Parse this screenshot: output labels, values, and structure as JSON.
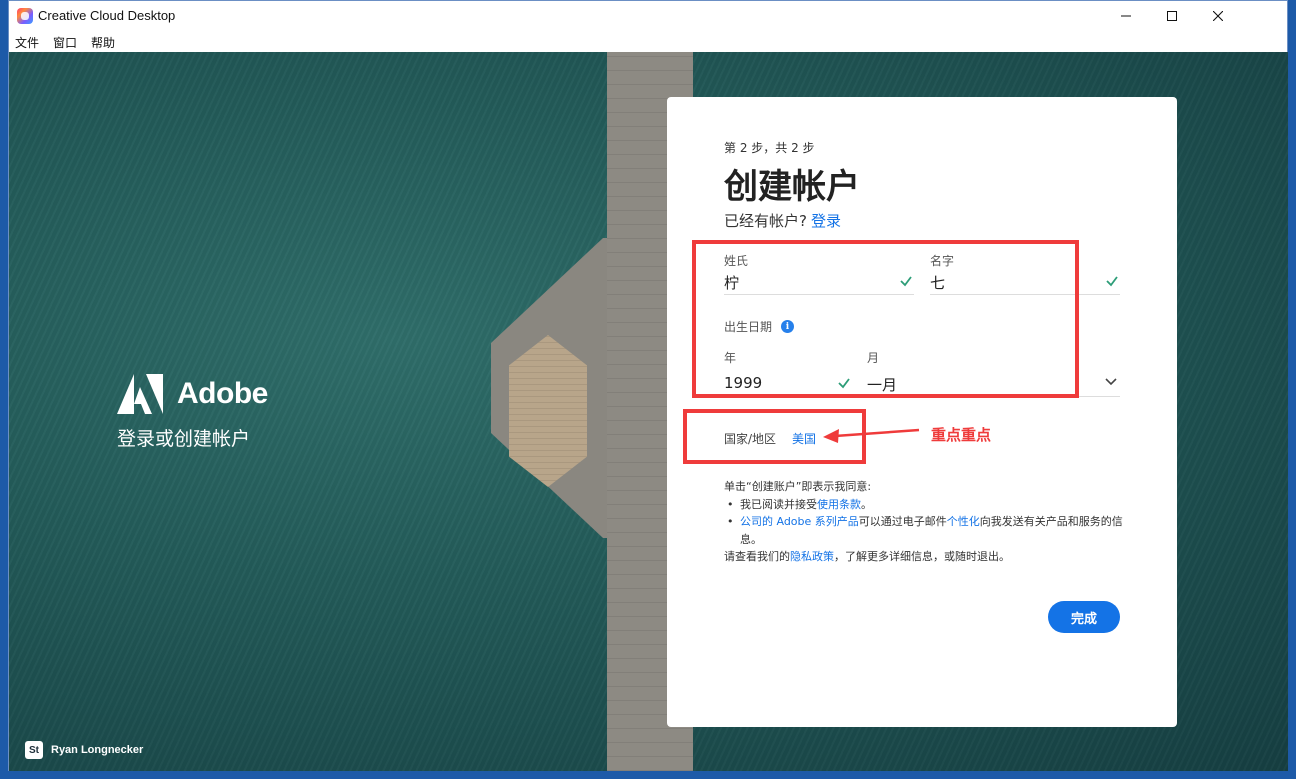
{
  "window": {
    "title": "Creative Cloud Desktop",
    "menu": [
      "文件",
      "窗口",
      "帮助"
    ]
  },
  "brand": {
    "wordmark": "Adobe",
    "subtitle": "登录或创建帐户",
    "photo_credit": "Ryan Longnecker",
    "credit_badge": "St"
  },
  "form": {
    "step": "第 2 步，共 2 步",
    "title": "创建帐户",
    "have_account_text": "已经有帐户?",
    "login_link": "登录",
    "last_name_label": "姓氏",
    "last_name_value": "柠",
    "first_name_label": "名字",
    "first_name_value": "七",
    "dob_label": "出生日期",
    "year_label": "年",
    "year_value": "1999",
    "month_label": "月",
    "month_value": "一月",
    "country_label": "国家/地区",
    "country_value": "美国",
    "terms_intro": "单击“创建账户”即表示我同意:",
    "terms_item1_prefix": "我已阅读并接受",
    "terms_item1_link": "使用条款",
    "terms_item1_suffix": "。",
    "terms_item2_link1": "公司的 Adobe 系列产品",
    "terms_item2_mid": "可以通过电子邮件",
    "terms_item2_link2": "个性化",
    "terms_item2_suffix": "向我发送有关产品和服务的信息。",
    "privacy_prefix": "请查看我们的",
    "privacy_link": "隐私政策",
    "privacy_suffix": "，了解更多详细信息，或随时退出。",
    "done_button": "完成"
  },
  "annotation": {
    "note": "重点重点",
    "color": "#ef3b3b"
  },
  "colors": {
    "accent": "#1473e6",
    "valid_check": "#2d9d78"
  }
}
